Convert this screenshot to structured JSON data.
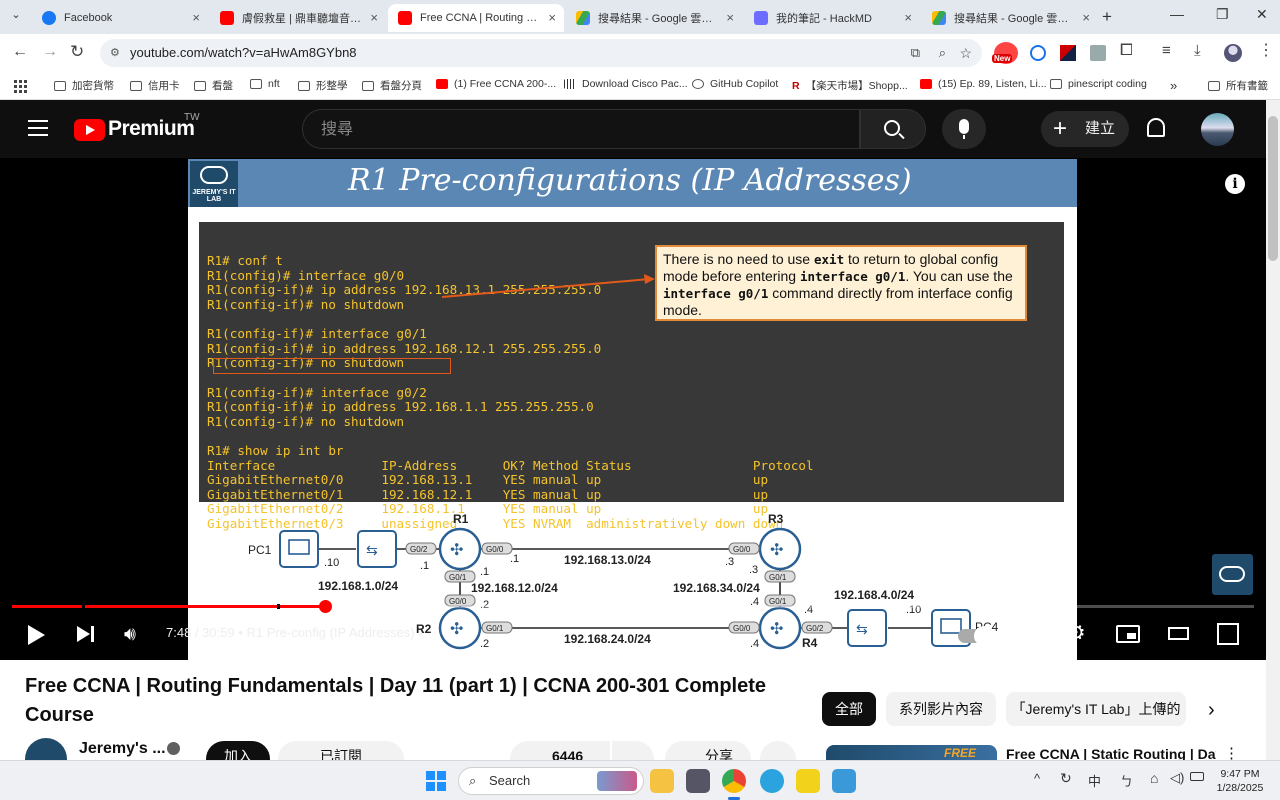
{
  "browser": {
    "tabs": [
      {
        "title": "Facebook",
        "favicon_color": "#1877f2",
        "active": false
      },
      {
        "title": "膚假救星 | 鼎車聽壇音（de",
        "favicon_color": "#ff0000",
        "active": false
      },
      {
        "title": "Free CCNA | Routing Fund...",
        "favicon_color": "#ff0000",
        "active": true
      },
      {
        "title": "搜尋結果 - Google 雲端硬...",
        "favicon_color": "#34a853",
        "active": false
      },
      {
        "title": "我的筆記 - HackMD",
        "favicon_color": "#6c6cff",
        "active": false
      },
      {
        "title": "搜尋結果 - Google 雲端硬...",
        "favicon_color": "#34a853",
        "active": false
      }
    ],
    "url": "youtube.com/watch?v=aHwAm8GYbn8",
    "bookmarks": [
      "加密貨幣",
      "信用卡",
      "看盤",
      "nft",
      "形整學",
      "看盤分頁",
      "(1) Free CCNA 200-...",
      "Download Cisco Pac...",
      "GitHub Copilot",
      "【楽天市場】Shopp...",
      "(15) Ep. 89, Listen, Li...",
      "pinescript coding"
    ],
    "bookmarks_other": "所有書籤",
    "extension_badge": "New"
  },
  "youtube": {
    "logo_text": "Premium",
    "logo_region": "TW",
    "search_placeholder": "搜尋",
    "create_label": "建立"
  },
  "slide": {
    "title": "R1 Pre-configurations (IP Addresses)",
    "logo_text": "JEREMY'S IT LAB",
    "terminal_lines": [
      "R1# conf t",
      "R1(config)# interface g0/0",
      "R1(config-if)# ip address 192.168.13.1 255.255.255.0",
      "R1(config-if)# no shutdown",
      "",
      "R1(config-if)# interface g0/1",
      "R1(config-if)# ip address 192.168.12.1 255.255.255.0",
      "R1(config-if)# no shutdown",
      "",
      "R1(config-if)# interface g0/2",
      "R1(config-if)# ip address 192.168.1.1 255.255.255.0",
      "R1(config-if)# no shutdown",
      "",
      "R1# show ip int br",
      "Interface              IP-Address      OK? Method Status                Protocol",
      "GigabitEthernet0/0     192.168.13.1    YES manual up                    up",
      "GigabitEthernet0/1     192.168.12.1    YES manual up                    up",
      "GigabitEthernet0/2     192.168.1.1     YES manual up                    up",
      "GigabitEthernet0/3     unassigned      YES NVRAM  administratively down down"
    ],
    "callout": {
      "p1": "There is no need to use ",
      "c1": "exit",
      "p2": " to return to global config mode before entering ",
      "c2": "interface g0/1",
      "p3": ". You can use the ",
      "c3": "interface g0/1",
      "p4": " command directly from interface config mode."
    },
    "topology": {
      "pc1": "PC1",
      "pc4": "PC4",
      "r1": "R1",
      "r2": "R2",
      "r3": "R3",
      "r4": "R4",
      "net_1": "192.168.1.0/24",
      "net_13": "192.168.13.0/24",
      "net_12": "192.168.12.0/24",
      "net_34": "192.168.34.0/24",
      "net_4": "192.168.4.0/24",
      "net_24": "192.168.24.0/24",
      "if_g00": "G0/0",
      "if_g01": "G0/1",
      "if_g02": "G0/2",
      "h10": ".10",
      "h1": ".1",
      "h2": ".2",
      "h3": ".3",
      "h4": ".4"
    }
  },
  "player": {
    "current_time": "7:48",
    "duration": "30:59",
    "chapter": "R1 Pre-config (IP Addresses)",
    "progress": 0.252,
    "buffered": 0.28
  },
  "video": {
    "title": "Free CCNA | Routing Fundamentals | Day 11 (part 1) | CCNA 200-301 Complete Course",
    "channel": "Jeremy's ...",
    "join_label": "加入",
    "subscribed_label": "已訂閱",
    "likes": "6446",
    "share_label": "分享"
  },
  "sidebar": {
    "chips": [
      "全部",
      "系列影片內容",
      "「Jeremy's IT Lab」上傳的"
    ],
    "next_title": "Free CCNA | Static Routing | Day",
    "thumb_badge": "FREE"
  },
  "taskbar": {
    "search_label": "Search",
    "ime": "中",
    "time": "9:47 PM",
    "date": "1/28/2025"
  }
}
